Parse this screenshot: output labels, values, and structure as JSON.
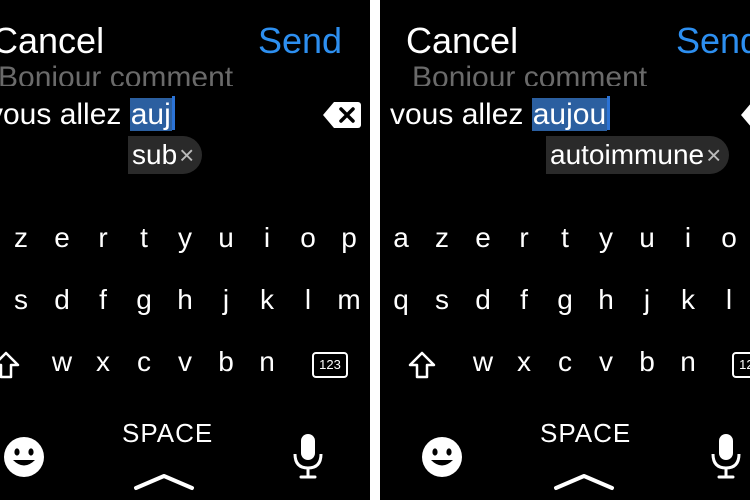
{
  "left": {
    "cancel_label": "Cancel",
    "send_label": "Send",
    "faded_text": "Bonjour comment",
    "text_before": "vous allez ",
    "highlighted": "auj",
    "suggestion": "sub",
    "suggestion_close": "×",
    "rows": [
      [
        "z",
        "e",
        "r",
        "t",
        "y",
        "u",
        "i",
        "o",
        "p"
      ],
      [
        "s",
        "d",
        "f",
        "g",
        "h",
        "j",
        "k",
        "l",
        "m"
      ],
      [
        "w",
        "x",
        "c",
        "v",
        "b",
        "n"
      ]
    ],
    "numbers_key": "123",
    "space_label": "SPACE"
  },
  "right": {
    "cancel_label": "Cancel",
    "send_label": "Send",
    "faded_text": "Bonjour comment",
    "text_before": "vous allez ",
    "highlighted": "aujou",
    "suggestion": "autoimmune",
    "suggestion_close": "×",
    "rows": [
      [
        "a",
        "z",
        "e",
        "r",
        "t",
        "y",
        "u",
        "i",
        "o"
      ],
      [
        "q",
        "s",
        "d",
        "f",
        "g",
        "h",
        "j",
        "k",
        "l"
      ],
      [
        "w",
        "x",
        "c",
        "v",
        "b",
        "n"
      ]
    ],
    "numbers_key": "123",
    "space_label": "SPACE"
  },
  "colors": {
    "background": "#000000",
    "send": "#2d8ff0",
    "highlight": "#2b5fa0",
    "faded": "#6a6a6a"
  },
  "icons": [
    "delete-icon",
    "shift-icon",
    "numbers-icon",
    "emoji-icon",
    "chevron-up-icon",
    "microphone-icon"
  ]
}
